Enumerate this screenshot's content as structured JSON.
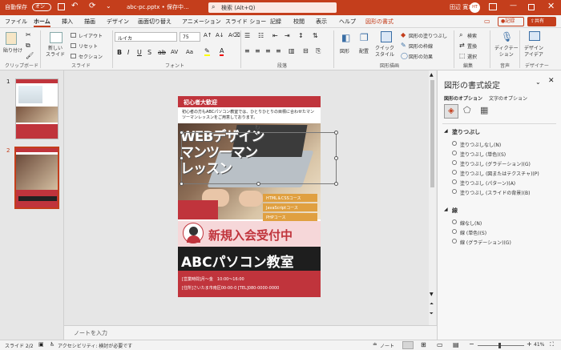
{
  "titlebar": {
    "autosave_label": "自動保存",
    "autosave_state": "オン",
    "file_name": "abc-pc.pptx • 保存中...",
    "search_placeholder": "検索 (Alt+Q)",
    "user_name": "田辺 寛幸",
    "user_initials": "HT"
  },
  "tabs": [
    "ファイル",
    "ホーム",
    "挿入",
    "描画",
    "デザイン",
    "画面切り替え",
    "アニメーション",
    "スライド ショー",
    "記録",
    "校閲",
    "表示",
    "ヘルプ",
    "図形の書式"
  ],
  "active_tab": "ホーム",
  "record_button": "記録",
  "share_button": "共有",
  "ribbon": {
    "clipboard": {
      "paste": "貼り付け",
      "group": "クリップボード"
    },
    "slides": {
      "new_slide": "新しい\nスライド",
      "layout": "レイアウト",
      "reset": "リセット",
      "section": "セクション",
      "group": "スライド"
    },
    "font": {
      "font_name": "ルイカ",
      "font_size": "75",
      "group": "フォント"
    },
    "paragraph": {
      "group": "段落"
    },
    "drawing": {
      "shapes": "図形",
      "arrange": "配置",
      "quick_styles": "クイック\nスタイル",
      "fill": "図形の塗りつぶし",
      "outline": "図形の枠線",
      "effects": "図形の効果",
      "group": "図形描画"
    },
    "editing": {
      "find": "検索",
      "replace": "置換",
      "select": "選択",
      "group": "編集"
    },
    "voice": {
      "dictate": "ディクテー\nション",
      "group": "音声"
    },
    "designer": {
      "design_ideas": "デザイン\nアイデア",
      "group": "デザイナー"
    }
  },
  "thumbnails": [
    {
      "number": "1"
    },
    {
      "number": "2"
    }
  ],
  "slide": {
    "header_label": "初心者大歓迎",
    "intro_text": "初心者の方もABCパソコン教室では、ひとりひとりの目標に合わせたマンツーマンレッスンをご用意しております。",
    "headline": "WEBデザイン\nマンツーマン\nレッスン",
    "courses": [
      "HTML＆CSSコース",
      "JavaScriptコース",
      "PHPコース"
    ],
    "recruit_text": "新規入会受付中",
    "school_name": "ABCパソコン教室",
    "hours": "[営業時間]月～金　10:00〜16:00",
    "address": "[住所]さいたま市南区00-00-0 [TEL]080-0000-0000"
  },
  "notes_placeholder": "ノートを入力",
  "format_pane": {
    "title": "図形の書式設定",
    "tab_shape_options": "図形のオプション",
    "tab_text_options": "文字のオプション",
    "fill_section": "塗りつぶし",
    "fill_options": [
      "塗りつぶしなし(N)",
      "塗りつぶし (単色)(S)",
      "塗りつぶし (グラデーション)(G)",
      "塗りつぶし (図またはテクスチャ)(P)",
      "塗りつぶし (パターン)(A)",
      "塗りつぶし (スライドの背景)(B)"
    ],
    "fill_selected_index": 0,
    "line_section": "線",
    "line_options": [
      "線なし(N)",
      "線 (単色)(S)",
      "線 (グラデーション)(G)"
    ],
    "line_selected_index": 0
  },
  "status": {
    "slide_counter": "スライド 2/2",
    "accessibility": "アクセシビリティ: 検討が必要です",
    "notes_button": "ノート",
    "zoom_level": "41%"
  },
  "colors": {
    "brand": "#c43e1c",
    "slide_red": "#c0343c",
    "course_orange": "#e0a040"
  }
}
